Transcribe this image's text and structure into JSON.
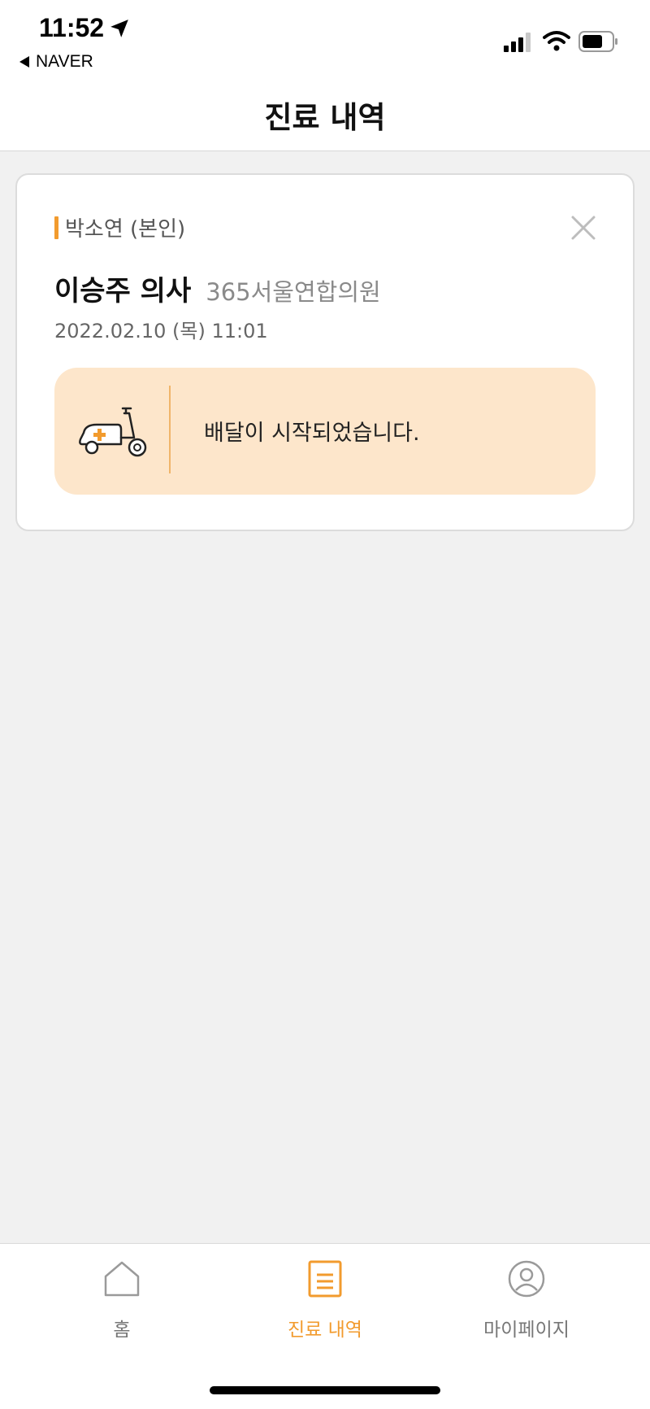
{
  "status_bar": {
    "time": "11:52",
    "back_app": "NAVER",
    "icons": [
      "location-arrow-icon",
      "signal-icon",
      "wifi-icon",
      "battery-icon"
    ]
  },
  "header": {
    "title": "진료 내역"
  },
  "record": {
    "patient": "박소연 (본인)",
    "doctor": "이승주 의사",
    "clinic": "365서울연합의원",
    "datetime": "2022.02.10 (목) 11:01",
    "delivery_status": "배달이 시작되었습니다.",
    "delivery_icon": "scooter-medical-icon",
    "close_icon": "close-icon"
  },
  "tab_bar": {
    "tabs": [
      {
        "label": "홈",
        "icon": "home-icon",
        "active": false
      },
      {
        "label": "진료 내역",
        "icon": "document-icon",
        "active": true
      },
      {
        "label": "마이페이지",
        "icon": "user-icon",
        "active": false
      }
    ]
  },
  "colors": {
    "accent": "#f29b2e",
    "delivery_bg": "#fde6cb",
    "background": "#f1f1f1"
  }
}
